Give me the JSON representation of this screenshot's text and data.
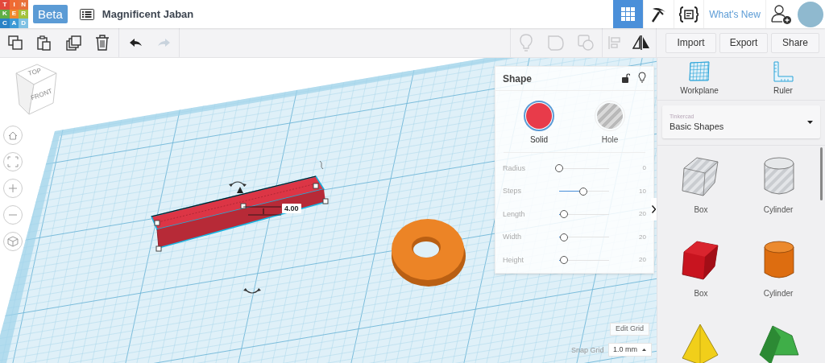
{
  "header": {
    "logo_letters": [
      {
        "letter": "T",
        "color": "#e2483c"
      },
      {
        "letter": "I",
        "color": "#ef6b33"
      },
      {
        "letter": "N",
        "color": "#e8713a"
      },
      {
        "letter": "K",
        "color": "#5fae46"
      },
      {
        "letter": "E",
        "color": "#f08a2c"
      },
      {
        "letter": "R",
        "color": "#a3c23d"
      },
      {
        "letter": "C",
        "color": "#2a82c6"
      },
      {
        "letter": "A",
        "color": "#3c9ad6"
      },
      {
        "letter": "D",
        "color": "#7fc1e3"
      }
    ],
    "beta_label": "Beta",
    "design_title": "Magnificent Jaban",
    "whats_new": "What's New"
  },
  "toolbar": {
    "buttons": [
      "Import",
      "Export",
      "Share"
    ]
  },
  "view_cube": {
    "top": "TOP",
    "front": "FRONT"
  },
  "dimension_label": "4.00",
  "shape_panel": {
    "title": "Shape",
    "types": [
      {
        "label": "Solid",
        "kind": "solid",
        "selected": true
      },
      {
        "label": "Hole",
        "kind": "hole",
        "selected": false
      }
    ],
    "sliders": [
      {
        "label": "Radius",
        "level": 0,
        "reading": "0"
      },
      {
        "label": "Steps",
        "level": 0.48,
        "reading": "10"
      },
      {
        "label": "Length",
        "level": 0.09,
        "reading": "20"
      },
      {
        "label": "Width",
        "level": 0.09,
        "reading": "20"
      },
      {
        "label": "Height",
        "level": 0.09,
        "reading": "20"
      }
    ]
  },
  "grid_controls": {
    "edit_grid": "Edit Grid",
    "snap_label": "Snap Grid",
    "snap_value": "1.0 mm"
  },
  "sidebar": {
    "tools": [
      {
        "label": "Workplane",
        "kind": "workplane"
      },
      {
        "label": "Ruler",
        "kind": "ruler"
      }
    ],
    "library": {
      "caption": "Tinkercad",
      "value": "Basic Shapes"
    },
    "shapes": [
      {
        "label": "Box",
        "kind": "box-hole"
      },
      {
        "label": "Cylinder",
        "kind": "cylinder-hole"
      },
      {
        "label": "Box",
        "kind": "box"
      },
      {
        "label": "Cylinder",
        "kind": "cylinder"
      },
      {
        "kind": "pyramid"
      },
      {
        "kind": "roof"
      }
    ]
  }
}
